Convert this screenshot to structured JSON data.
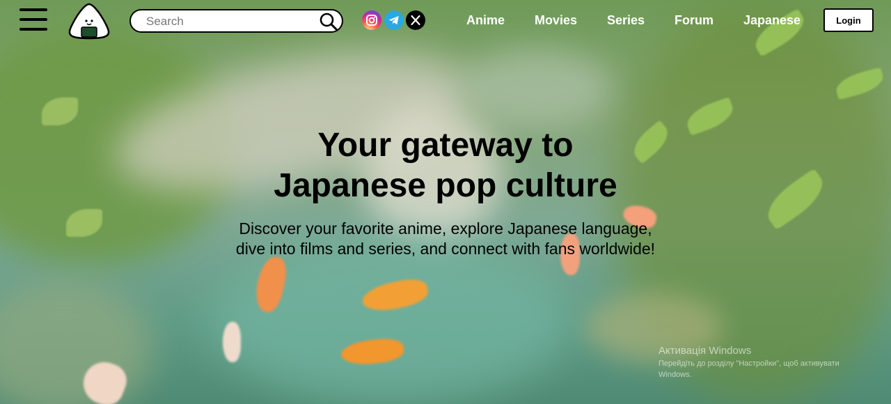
{
  "header": {
    "search": {
      "placeholder": "Search",
      "value": ""
    },
    "social": [
      {
        "name": "instagram-icon",
        "color": "#d6249f"
      },
      {
        "name": "telegram-icon",
        "color": "#2aa8e0"
      },
      {
        "name": "x-icon",
        "color": "#000000"
      }
    ],
    "nav": [
      "Anime",
      "Movies",
      "Series",
      "Forum",
      "Japanese"
    ],
    "login_label": "Login"
  },
  "hero": {
    "title_line1": "Your gateway to",
    "title_line2": "Japanese pop culture",
    "subtitle": "Discover your favorite anime, explore Japanese language, dive into films and series, and connect with fans worldwide!"
  },
  "watermark": {
    "title": "Активація Windows",
    "body": "Перейдіть до розділу \"Настройки\", щоб активувати Windows."
  }
}
